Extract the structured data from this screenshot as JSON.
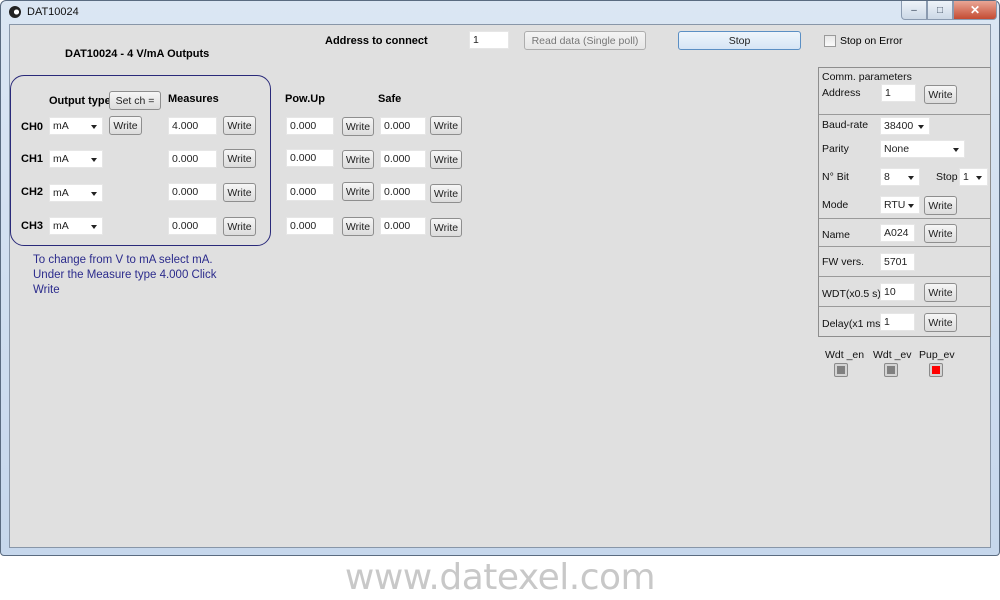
{
  "window": {
    "title": "DAT10024",
    "controls": {
      "minimize": "–",
      "maximize": "□",
      "close": "✕"
    }
  },
  "header": {
    "device_title": "DAT10024 - 4 V/mA Outputs",
    "address_label": "Address to connect",
    "address_value": "1",
    "read_button": "Read data (Single poll)",
    "stop_button": "Stop",
    "stop_on_error_label": "Stop on Error",
    "stop_on_error_checked": false
  },
  "channels": {
    "headers": {
      "output_type": "Output type",
      "set_ch": "Set ch =",
      "measures": "Measures",
      "pow_up": "Pow.Up",
      "safe": "Safe"
    },
    "write_label": "Write",
    "rows": [
      {
        "name": "CH0",
        "type": "mA",
        "measure": "4.000",
        "pow_up": "0.000",
        "safe": "0.000"
      },
      {
        "name": "CH1",
        "type": "mA",
        "measure": "0.000",
        "pow_up": "0.000",
        "safe": "0.000"
      },
      {
        "name": "CH2",
        "type": "mA",
        "measure": "0.000",
        "pow_up": "0.000",
        "safe": "0.000"
      },
      {
        "name": "CH3",
        "type": "mA",
        "measure": "0.000",
        "pow_up": "0.000",
        "safe": "0.000"
      }
    ]
  },
  "note": "To change from V to mA select mA. Under the Measure type 4.000 Click Write",
  "comm": {
    "title": "Comm. parameters",
    "address_label": "Address",
    "address_value": "1",
    "baud_label": "Baud-rate",
    "baud_value": "38400",
    "parity_label": "Parity",
    "parity_value": "None",
    "nbit_label": "N° Bit",
    "nbit_value": "8",
    "stop_label": "Stop",
    "stop_value": "1",
    "mode_label": "Mode",
    "mode_value": "RTU",
    "name_label": "Name",
    "name_value": "A024",
    "fw_label": "FW vers.",
    "fw_value": "5701",
    "wdt_label": "WDT(x0.5 s)",
    "wdt_value": "10",
    "delay_label": "Delay(x1 ms)",
    "delay_value": "1",
    "write_label": "Write"
  },
  "indicators": [
    {
      "label": "Wdt _en",
      "color": "#808080"
    },
    {
      "label": "Wdt _ev",
      "color": "#808080"
    },
    {
      "label": "Pup_ev",
      "color": "#ff0000"
    }
  ],
  "watermark": "www.datexel.com"
}
